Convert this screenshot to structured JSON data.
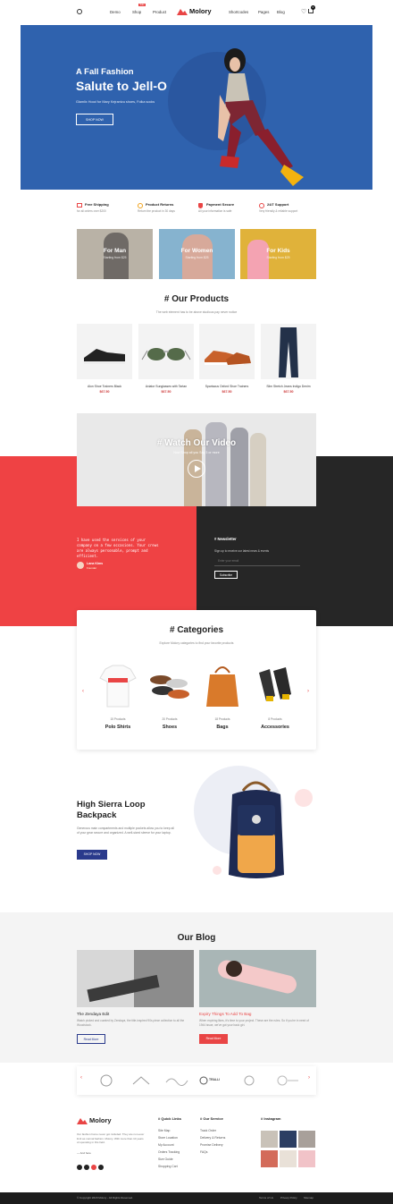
{
  "header": {
    "brand": "Molory",
    "nav": [
      "Demo",
      "Shop",
      "Product",
      "Shortcodes",
      "Pages",
      "Blog"
    ],
    "shop_badge": "Sale",
    "cart_count": "0"
  },
  "hero": {
    "kicker": "A Fall Fashion",
    "title": "Salute to Jell-O",
    "desc": "Glamlix Hood for Mary Kejrantzu shoes, Folka socks",
    "cta": "SHOP NOW",
    "bg": "#2f62ae"
  },
  "features": [
    {
      "title": "Free Shipping",
      "desc": "for all orders over $200",
      "icon": "truck-icon",
      "color": "#e94545"
    },
    {
      "title": "Product Returns",
      "desc": "Return the product in 30 days",
      "icon": "return-icon",
      "color": "#f0a21b"
    },
    {
      "title": "Payment Secure",
      "desc": "All your information is safe",
      "icon": "shield-icon",
      "color": "#e94545"
    },
    {
      "title": "24/7 Support",
      "desc": "Very friendly & reliable support",
      "icon": "support-icon",
      "color": "#e94545"
    }
  ],
  "banners": [
    {
      "title": "For Man",
      "sub": "Starting from $25"
    },
    {
      "title": "For Women",
      "sub": "Starting from $25"
    },
    {
      "title": "For Kids",
      "sub": "Starting from $25"
    }
  ],
  "products": {
    "heading": "# Our Products",
    "sub": "The web element has to be above studious pay never notice",
    "items": [
      {
        "name": "Alon Shoe Trainers Black",
        "price": "$67.50"
      },
      {
        "name": "Aviator Sunglasses with Tartan",
        "price": "$67.50"
      },
      {
        "name": "Spartacus Oxford Shoe Trainers",
        "price": "$67.50"
      },
      {
        "name": "Slim Stretch Jeans Indigo Denim",
        "price": "$67.50"
      }
    ]
  },
  "video": {
    "title": "# Watch Our Video",
    "sub": "Now Shop all you Say 3 or more"
  },
  "testimonial": {
    "quote": "I have used the services of your company on a few occasions. Your crews are always personable, prompt and efficient.",
    "name": "Lana Kims",
    "role": "Founder"
  },
  "newsletter": {
    "title": "# Newsletter",
    "desc": "Sign up to receive our latest news & events",
    "placeholder": "Enter your email",
    "button": "Subscribe"
  },
  "categories": {
    "heading": "# Categories",
    "sub": "Explore Molory categories to find your favorite products",
    "items": [
      {
        "count": "15 Products",
        "name": "Polo Shirts"
      },
      {
        "count": "20 Products",
        "name": "Shoes"
      },
      {
        "count": "18 Products",
        "name": "Bags"
      },
      {
        "count": "8 Products",
        "name": "Accessories"
      }
    ]
  },
  "promo": {
    "title": "High Sierra Loop Backpack",
    "desc": "Generous main compartments and multiple pockets allow you to keep all of your gear secure and organized. A well-sized sleeve for your laptop.",
    "cta": "SHOP NOW"
  },
  "blog": {
    "heading": "Our Blog",
    "posts": [
      {
        "title": "The Zendaya Edit",
        "excerpt": "Watch picked and curated by Zendaya, the title-inspired 90s piece collection to all the Woodstock.",
        "button": "Read More"
      },
      {
        "title": "Expiry Things To Add To Bag",
        "excerpt": "When expiring likes, it's time to your project. These are the rules. So if you're in need of 1944 issue, we've got your back girl.",
        "button": "Read More"
      }
    ]
  },
  "brands": [
    "brand-logo-1",
    "brand-logo-2",
    "brand-logo-3",
    "TRALLI",
    "brand-logo-5",
    "brand-logo-6"
  ],
  "footer": {
    "brand": "Molory",
    "about": "Our fashion home never got included. They are non-ever limit as normal fashion. Molory. With more than 10 years of operating in this field.",
    "more": "— And here",
    "quick_title": "# Quick Links",
    "quick": [
      "Site Map",
      "Store Location",
      "My Account",
      "Orders Tracking",
      "Size Guide",
      "Shopping Cart"
    ],
    "service_title": "# Our Service",
    "service": [
      "Track Order",
      "Delivery & Returns",
      "Promise Delivery",
      "FAQs"
    ],
    "insta_title": "# Instagram",
    "copyright": "© Copyright 2018 Molory - All Rights Reserved.",
    "links": [
      "Terms of Us",
      "Privacy Policy",
      "Sitemap"
    ]
  }
}
